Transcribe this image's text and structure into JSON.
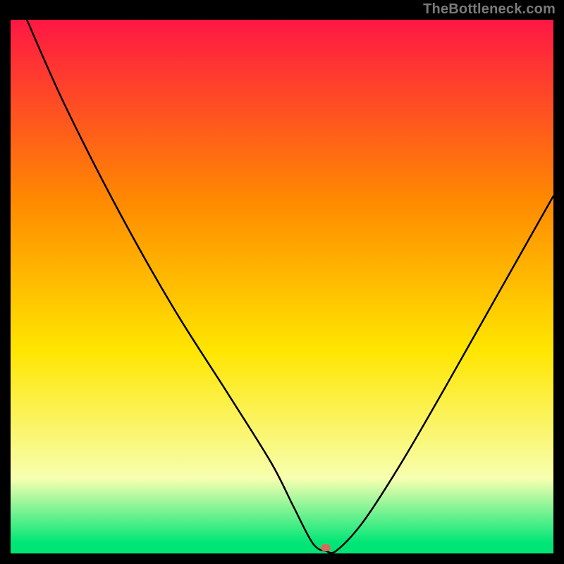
{
  "watermark": "TheBottleneck.com",
  "colors": {
    "bg_top": "#ff1744",
    "bg_mid1": "#ff8a00",
    "bg_mid2": "#ffe600",
    "bg_low": "#f7ffb0",
    "bg_bottom": "#00e676",
    "curve": "#000000",
    "marker": "#d96a5b",
    "frame": "#000000"
  },
  "chart_data": {
    "type": "line",
    "title": "",
    "xlabel": "",
    "ylabel": "",
    "xlim": [
      0,
      100
    ],
    "ylim": [
      0,
      100
    ],
    "grid": false,
    "series": [
      {
        "name": "bottleneck-curve",
        "x": [
          3,
          10,
          20,
          30,
          40,
          48,
          52,
          55,
          56.5,
          58,
          60,
          65,
          72,
          80,
          90,
          100
        ],
        "y": [
          100,
          84,
          64,
          46,
          30,
          17,
          9,
          3,
          1,
          0.5,
          0.5,
          6,
          17,
          31,
          49,
          67
        ]
      }
    ],
    "marker": {
      "x": 58,
      "y": 1
    },
    "gradient_stops": [
      {
        "pct": 0,
        "color": "#ff1744"
      },
      {
        "pct": 34,
        "color": "#ff8a00"
      },
      {
        "pct": 62,
        "color": "#ffe600"
      },
      {
        "pct": 86,
        "color": "#f7ffb0"
      },
      {
        "pct": 98,
        "color": "#00e676"
      },
      {
        "pct": 100,
        "color": "#00e676"
      }
    ]
  }
}
